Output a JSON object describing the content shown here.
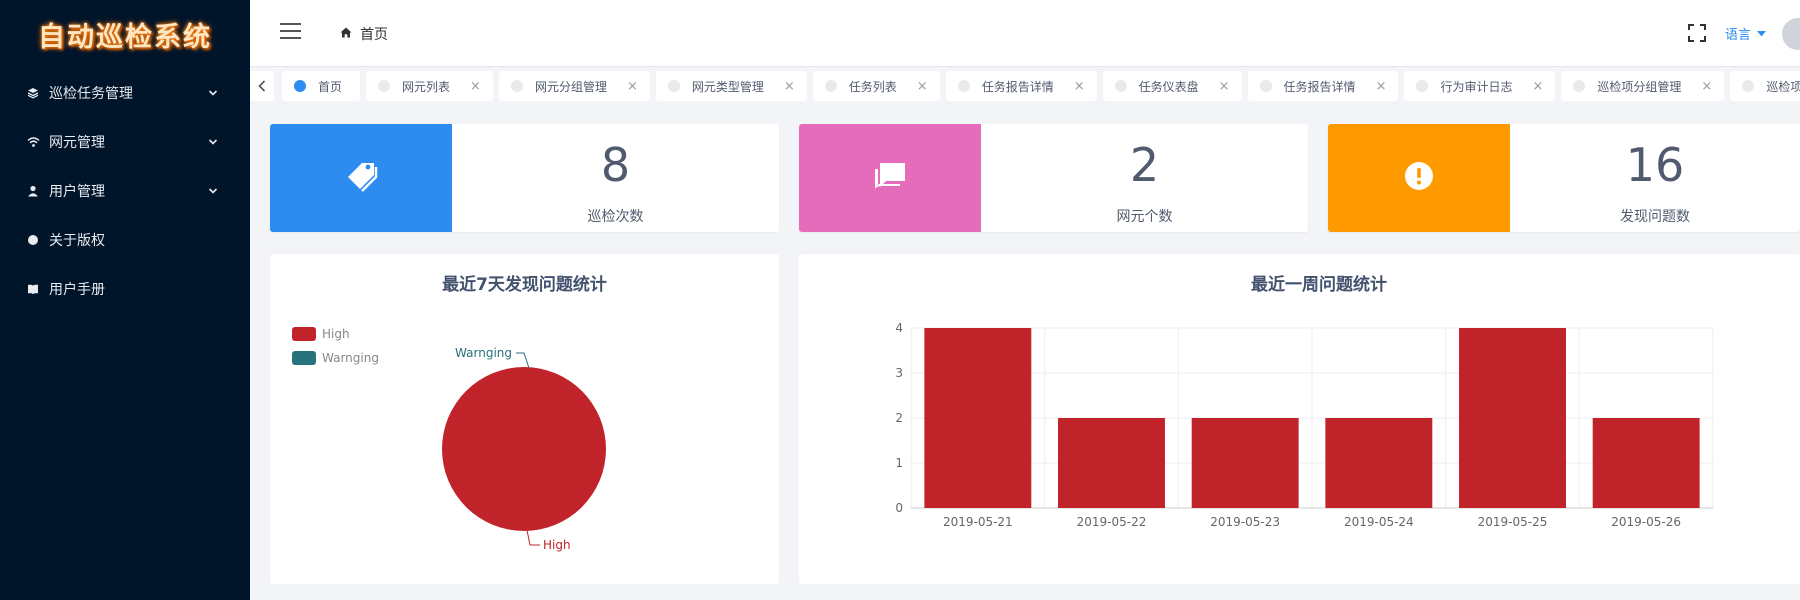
{
  "app": {
    "title": "自动巡检系统"
  },
  "sidebar": {
    "items": [
      {
        "label": "巡检任务管理",
        "icon": "layers-icon",
        "has_children": true
      },
      {
        "label": "网元管理",
        "icon": "wifi-icon",
        "has_children": true
      },
      {
        "label": "用户管理",
        "icon": "user-icon",
        "has_children": true
      },
      {
        "label": "关于版权",
        "icon": "circle-icon",
        "has_children": false
      },
      {
        "label": "用户手册",
        "icon": "book-icon",
        "has_children": false
      }
    ]
  },
  "header": {
    "breadcrumb": "首页",
    "language_label": "语言"
  },
  "tabs": [
    {
      "label": "首页",
      "active": true,
      "closable": false
    },
    {
      "label": "网元列表",
      "closable": true
    },
    {
      "label": "网元分组管理",
      "closable": true
    },
    {
      "label": "网元类型管理",
      "closable": true
    },
    {
      "label": "任务列表",
      "closable": true
    },
    {
      "label": "任务报告详情",
      "closable": true
    },
    {
      "label": "任务仪表盘",
      "closable": true
    },
    {
      "label": "任务报告详情",
      "closable": true
    },
    {
      "label": "行为审计日志",
      "closable": true
    },
    {
      "label": "巡检项分组管理",
      "closable": true
    },
    {
      "label": "巡检项管理",
      "closable": true
    }
  ],
  "stats": [
    {
      "value": "8",
      "label": "巡检次数",
      "color": "#2d8cf0",
      "icon": "tags-icon"
    },
    {
      "value": "2",
      "label": "网元个数",
      "color": "#e46cbb",
      "icon": "chat-icon"
    },
    {
      "value": "16",
      "label": "发现问题数",
      "color": "#ff9900",
      "icon": "alert-icon"
    }
  ],
  "pie_panel": {
    "title": "最近7天发现问题统计"
  },
  "bar_panel": {
    "title": "最近一周问题统计"
  },
  "chart_data": [
    {
      "type": "pie",
      "title": "最近7天发现问题统计",
      "legend_position": "top-left",
      "slices": [
        {
          "name": "High",
          "value": 16,
          "color": "#c1232b"
        },
        {
          "name": "Warnging",
          "value": 0,
          "color": "#27727b"
        }
      ]
    },
    {
      "type": "bar",
      "title": "最近一周问题统计",
      "categories": [
        "2019-05-21",
        "2019-05-22",
        "2019-05-23",
        "2019-05-24",
        "2019-05-25",
        "2019-05-26"
      ],
      "values": [
        4,
        2,
        2,
        2,
        4,
        2
      ],
      "ylim": [
        0,
        4
      ],
      "yticks": [
        0,
        1,
        2,
        3,
        4
      ],
      "color": "#c1232b",
      "grid": true
    }
  ]
}
